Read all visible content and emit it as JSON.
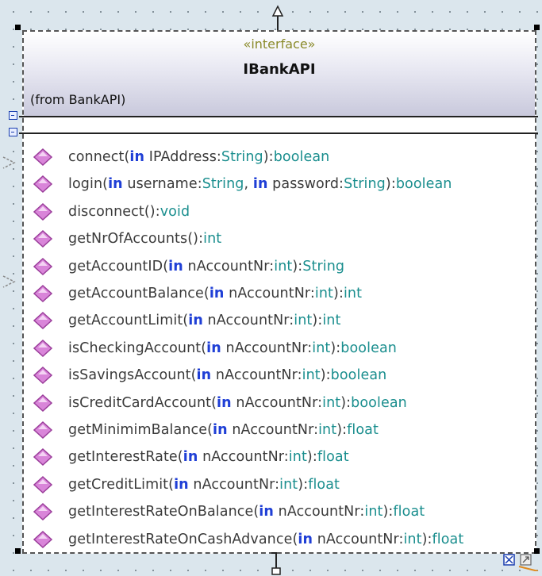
{
  "class": {
    "stereotype": "«interface»",
    "name": "IBankAPI",
    "from": "(from BankAPI)"
  },
  "operations": [
    {
      "name": "connect(",
      "params": [
        {
          "kw": "in",
          "name": " IPAddress:",
          "type": "String"
        }
      ],
      "ret": "):",
      "rtype": "boolean"
    },
    {
      "name": "login(",
      "params": [
        {
          "kw": "in",
          "name": " username:",
          "type": "String"
        },
        {
          "kw": "in",
          "name": " password:",
          "type": "String"
        }
      ],
      "ret": "):",
      "rtype": "boolean"
    },
    {
      "name": "disconnect(",
      "params": [],
      "ret": "):",
      "rtype": "void"
    },
    {
      "name": "getNrOfAccounts(",
      "params": [],
      "ret": "):",
      "rtype": "int"
    },
    {
      "name": "getAccountID(",
      "params": [
        {
          "kw": "in",
          "name": " nAccountNr:",
          "type": "int"
        }
      ],
      "ret": "):",
      "rtype": "String"
    },
    {
      "name": "getAccountBalance(",
      "params": [
        {
          "kw": "in",
          "name": " nAccountNr:",
          "type": "int"
        }
      ],
      "ret": "):",
      "rtype": "int"
    },
    {
      "name": "getAccountLimit(",
      "params": [
        {
          "kw": "in",
          "name": " nAccountNr:",
          "type": "int"
        }
      ],
      "ret": "):",
      "rtype": "int"
    },
    {
      "name": "isCheckingAccount(",
      "params": [
        {
          "kw": "in",
          "name": " nAccountNr:",
          "type": "int"
        }
      ],
      "ret": "):",
      "rtype": "boolean"
    },
    {
      "name": "isSavingsAccount(",
      "params": [
        {
          "kw": "in",
          "name": " nAccountNr:",
          "type": "int"
        }
      ],
      "ret": "):",
      "rtype": "boolean"
    },
    {
      "name": "isCreditCardAccount(",
      "params": [
        {
          "kw": "in",
          "name": " nAccountNr:",
          "type": "int"
        }
      ],
      "ret": "):",
      "rtype": "boolean"
    },
    {
      "name": "getMinimimBalance(",
      "params": [
        {
          "kw": "in",
          "name": " nAccountNr:",
          "type": "int"
        }
      ],
      "ret": "):",
      "rtype": "float"
    },
    {
      "name": "getInterestRate(",
      "params": [
        {
          "kw": "in",
          "name": " nAccountNr:",
          "type": "int"
        }
      ],
      "ret": "):",
      "rtype": "float"
    },
    {
      "name": "getCreditLimit(",
      "params": [
        {
          "kw": "in",
          "name": " nAccountNr:",
          "type": "int"
        }
      ],
      "ret": "):",
      "rtype": "float"
    },
    {
      "name": "getInterestRateOnBalance(",
      "params": [
        {
          "kw": "in",
          "name": " nAccountNr:",
          "type": "int"
        }
      ],
      "ret": "):",
      "rtype": "float"
    },
    {
      "name": "getInterestRateOnCashAdvance(",
      "params": [
        {
          "kw": "in",
          "name": " nAccountNr:",
          "type": "int"
        }
      ],
      "ret": "):",
      "rtype": "float"
    }
  ],
  "icons": {
    "operation": "public-operation-icon",
    "compartment_toggle": "collapse-compartment-icon",
    "bottom_right": [
      "resize-icon",
      "link-icon"
    ]
  },
  "colors": {
    "keyword": "#1f3fd6",
    "type": "#1a8e8e",
    "stereotype": "#8a8a2a",
    "gem": "#d985d9",
    "border": "#555555"
  }
}
